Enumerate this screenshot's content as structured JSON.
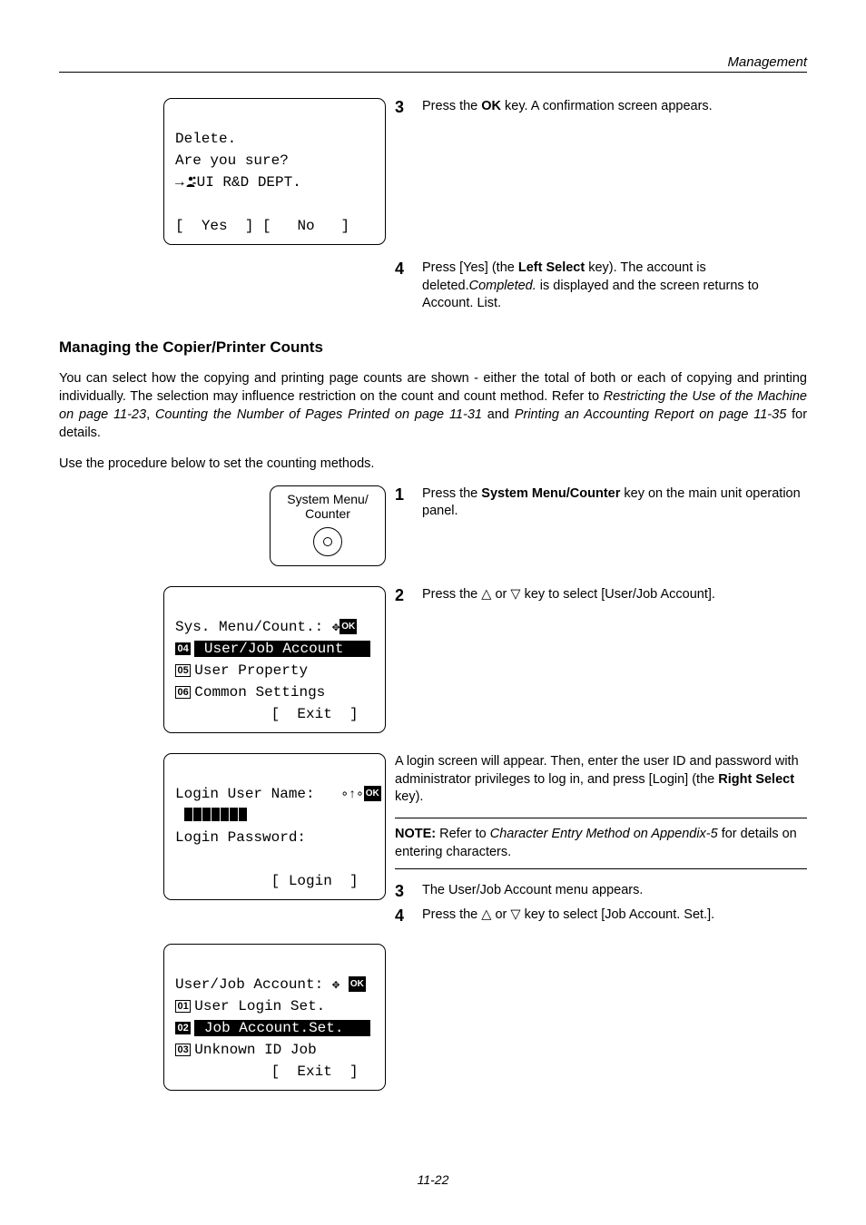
{
  "header": {
    "title": "Management"
  },
  "lcd_delete": {
    "l1": "Delete.",
    "l2": "Are you sure?",
    "dept": "UI R&D DEPT.",
    "yes": "Yes",
    "no": "No"
  },
  "steps_a": {
    "s3": "3",
    "t3_pre": "Press the ",
    "t3_key": "OK",
    "t3_post": " key. A confirmation screen appears.",
    "s4": "4",
    "t4_pre": "Press [Yes] (the ",
    "t4_key": "Left Select",
    "t4_mid": " key). The account is deleted.",
    "t4_it": "Completed.",
    "t4_post": " is displayed and the screen returns to Account. List."
  },
  "section_title": "Managing the Copier/Printer Counts",
  "para1_a": "You can select how the copying and printing page counts are shown - either the total of both or each of copying and printing individually. The selection may influence restriction on the count and count method. Refer to ",
  "para1_i1": "Restricting the Use of the Machine on page 11-23",
  "para1_b": ", ",
  "para1_i2": "Counting the Number of Pages Printed on page 11-31",
  "para1_c": " and ",
  "para1_i3": "Printing an Accounting Report on page 11-35",
  "para1_d": " for details.",
  "para2": "Use the procedure below to set the counting methods.",
  "menu_key": {
    "l1": "System Menu/",
    "l2": "Counter"
  },
  "steps_b": {
    "s1": "1",
    "t1_pre": "Press the ",
    "t1_key": "System Menu/Counter",
    "t1_post": " key on the main unit operation panel.",
    "s2": "2",
    "t2_pre": "Press the ",
    "t2_up": "△",
    "t2_or": " or ",
    "t2_dn": "▽",
    "t2_post": " key to select [User/Job Account].",
    "login_text_a": "A login screen will appear. Then, enter the user ID and password with administrator privileges to log in, and press [Login] (the ",
    "login_key": "Right Select",
    "login_text_b": " key).",
    "note_label": "NOTE:",
    "note_pre": " Refer to ",
    "note_it": "Character Entry Method on Appendix-5",
    "note_post": " for details on entering characters.",
    "s3": "3",
    "t3": "The User/Job Account menu appears.",
    "s4": "4",
    "t4_pre": "Press the ",
    "t4_post": " key to select [Job Account. Set.]."
  },
  "lcd_sys": {
    "title": "Sys. Menu/Count.:",
    "n4": "04",
    "i4": "User/Job Account",
    "n5": "05",
    "i5": "User Property",
    "n6": "06",
    "i6": "Common Settings",
    "exit": "Exit"
  },
  "lcd_login": {
    "l1": "Login User Name:",
    "l2": "Login Password:",
    "login": "Login"
  },
  "lcd_user": {
    "title": "User/Job Account:",
    "n1": "01",
    "i1": "User Login Set.",
    "n2": "02",
    "i2": "Job Account.Set.",
    "n3": "03",
    "i3": "Unknown ID Job",
    "exit": "Exit"
  },
  "ok_label": "OK",
  "footer": "11-22"
}
